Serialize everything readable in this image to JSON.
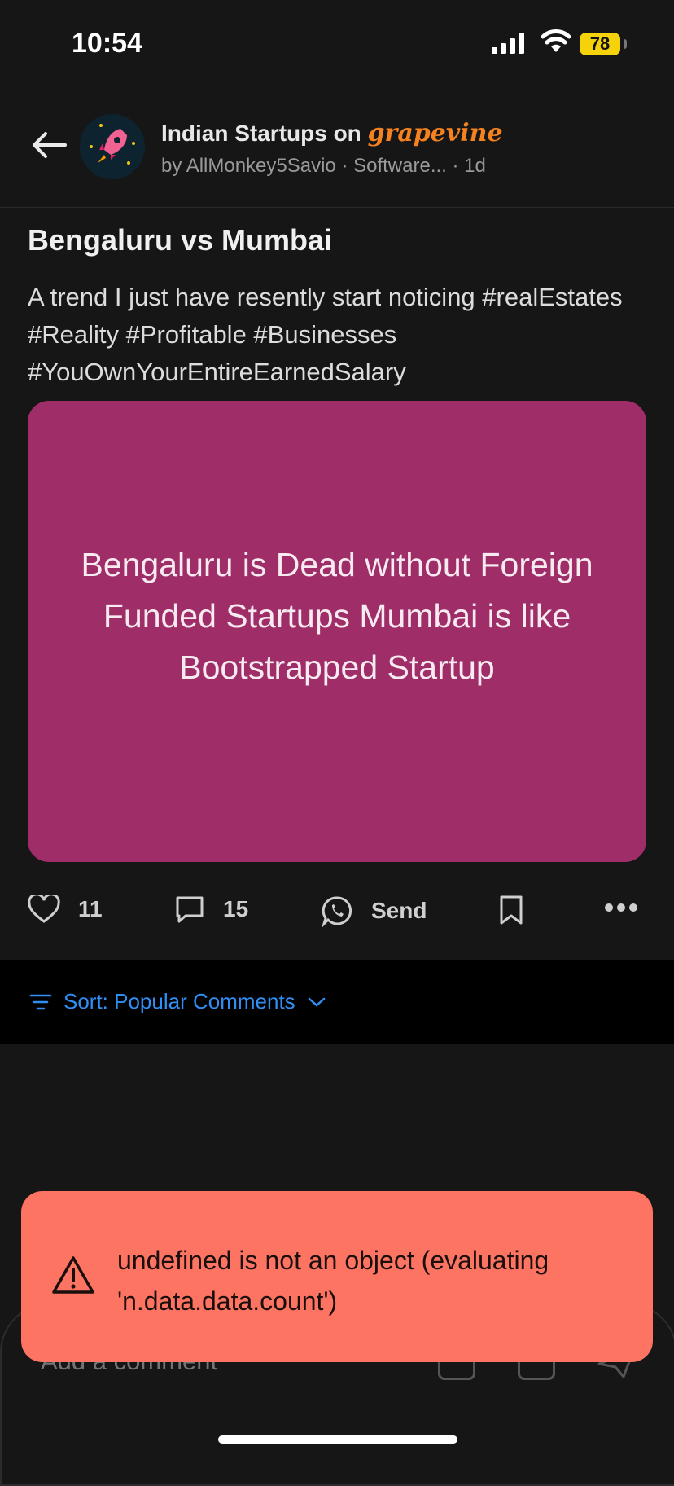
{
  "status_bar": {
    "time": "10:54",
    "battery": "78"
  },
  "header": {
    "group_name": "Indian Startups on ",
    "brand": "grapevine",
    "byline": "by AllMonkey5Savio · Software... · 1d"
  },
  "post": {
    "title": "Bengaluru vs Mumbai",
    "body": "A trend I just have resently start noticing #realEstates #Reality #Profitable #Businesses #YouOwnYourEntireEarnedSalary",
    "image_text": "Bengaluru is Dead without Foreign Funded Startups Mumbai is like Bootstrapped Startup",
    "image_color": "#9e2d68"
  },
  "actions": {
    "likes": "11",
    "comments": "15",
    "send_label": "Send"
  },
  "sort": {
    "label": "Sort: Popular Comments"
  },
  "comment_input": {
    "placeholder": "Add a comment"
  },
  "toast": {
    "message": "undefined is not an object (evaluating 'n.data.data.count')",
    "color": "#fd7462"
  }
}
